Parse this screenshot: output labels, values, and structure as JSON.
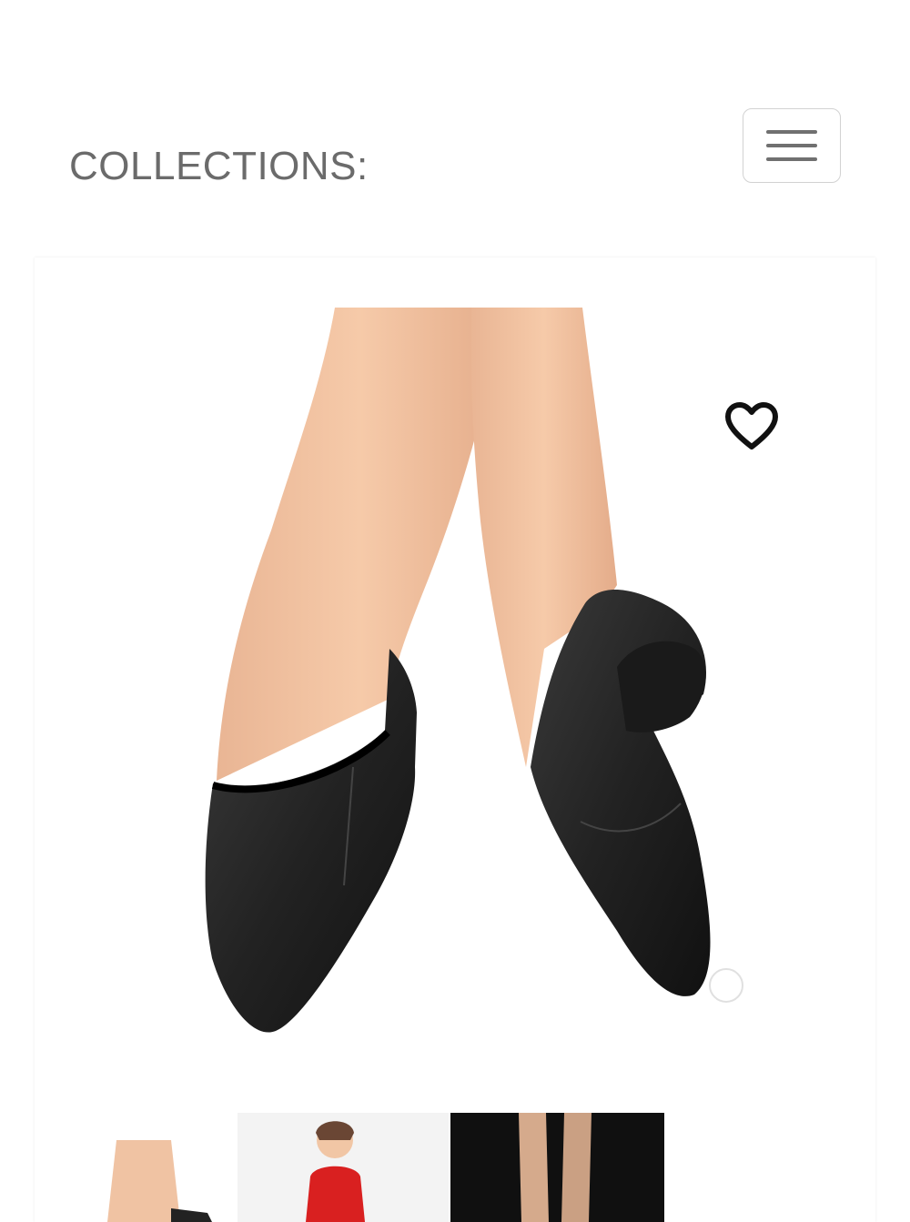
{
  "header": {
    "title": "COLLECTIONS:",
    "menu_icon": "hamburger-menu-icon"
  },
  "product": {
    "wishlist_icon": "heart-outline-icon",
    "thumbnails": [
      {
        "id": "thumb-1"
      },
      {
        "id": "thumb-2"
      },
      {
        "id": "thumb-3"
      }
    ]
  }
}
